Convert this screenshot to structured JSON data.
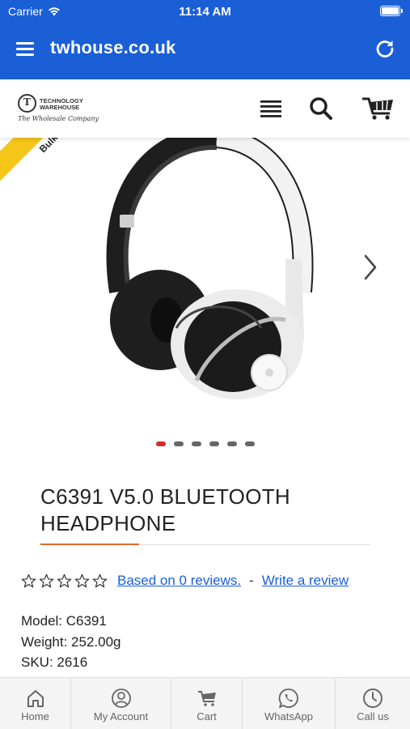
{
  "status": {
    "carrier": "Carrier",
    "time": "11:14 AM"
  },
  "toolbar": {
    "title": "twhouse.co.uk"
  },
  "logo": {
    "line1": "TECHNOLOGY",
    "line2": "WAREHOUSE",
    "tagline": "The Wholesale Company"
  },
  "header_icons": [
    "hamburger-menu-icon",
    "search-icon",
    "cart-icon"
  ],
  "gallery": {
    "ribbon_label": "Bulk",
    "dot_count": 6,
    "active_dot": 0
  },
  "product": {
    "title_line1": "C6391 V5.0 BLUETOOTH",
    "title_line2": "HEADPHONE",
    "rating_stars": 0,
    "reviews_link": "Based on 0 reviews.",
    "separator": "-",
    "write_review": "Write a review",
    "model": "Model: C6391",
    "weight": "Weight: 252.00g",
    "sku": "SKU: 2616"
  },
  "tabs": [
    {
      "label": "Home",
      "icon": "home-icon"
    },
    {
      "label": "My Account",
      "icon": "account-icon"
    },
    {
      "label": "Cart",
      "icon": "cart-icon"
    },
    {
      "label": "WhatsApp",
      "icon": "whatsapp-icon"
    },
    {
      "label": "Call us",
      "icon": "phone-icon"
    }
  ],
  "colors": {
    "primary": "#1a5fd6",
    "accent": "#e06a2e",
    "active_dot": "#d62b2b",
    "ribbon": "#f5c518"
  }
}
